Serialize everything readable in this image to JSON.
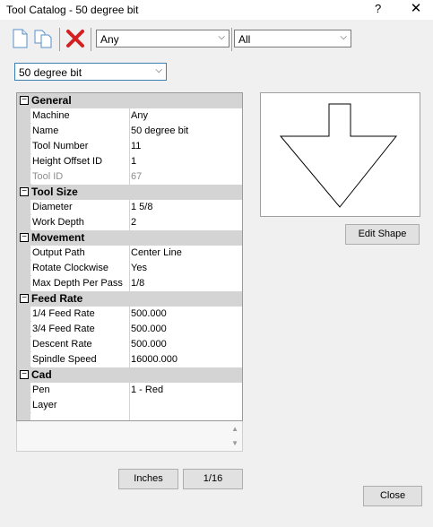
{
  "window": {
    "title": "Tool Catalog - 50 degree bit",
    "help_label": "?",
    "close_label": "✕"
  },
  "toolbar": {
    "new_icon": "new-document-icon",
    "copy_icon": "copy-document-icon",
    "delete_icon": "delete-x-icon",
    "filter1_value": "Any",
    "filter2_value": "All"
  },
  "tool_select": {
    "value": "50 degree bit"
  },
  "properties": {
    "general": {
      "label": "General",
      "toggle": "−",
      "rows": [
        {
          "name": "Machine",
          "value": "Any"
        },
        {
          "name": "Name",
          "value": "50 degree bit"
        },
        {
          "name": "Tool Number",
          "value": "11"
        },
        {
          "name": "Height Offset ID",
          "value": "1"
        },
        {
          "name": "Tool ID",
          "value": "67"
        }
      ]
    },
    "tool_size": {
      "label": "Tool Size",
      "toggle": "−",
      "rows": [
        {
          "name": "Diameter",
          "value": "1 5/8"
        },
        {
          "name": "Work Depth",
          "value": "2"
        }
      ]
    },
    "movement": {
      "label": "Movement",
      "toggle": "−",
      "rows": [
        {
          "name": "Output Path",
          "value": "Center Line"
        },
        {
          "name": "Rotate Clockwise",
          "value": "Yes"
        },
        {
          "name": "Max Depth Per Pass",
          "value": "1/8"
        }
      ]
    },
    "feed_rate": {
      "label": "Feed Rate",
      "toggle": "−",
      "rows": [
        {
          "name": "1/4 Feed Rate",
          "value": "500.000"
        },
        {
          "name": "3/4 Feed Rate",
          "value": "500.000"
        },
        {
          "name": "Descent Rate",
          "value": "500.000"
        },
        {
          "name": "Spindle Speed",
          "value": "16000.000"
        }
      ]
    },
    "cad": {
      "label": "Cad",
      "toggle": "−",
      "rows": [
        {
          "name": "Pen",
          "value": "1 - Red"
        },
        {
          "name": "Layer",
          "value": ""
        }
      ]
    }
  },
  "buttons": {
    "edit_shape": "Edit Shape",
    "inches": "Inches",
    "fraction": "1/16",
    "close": "Close"
  },
  "scroll": {
    "up": "▲",
    "down": "▼"
  }
}
